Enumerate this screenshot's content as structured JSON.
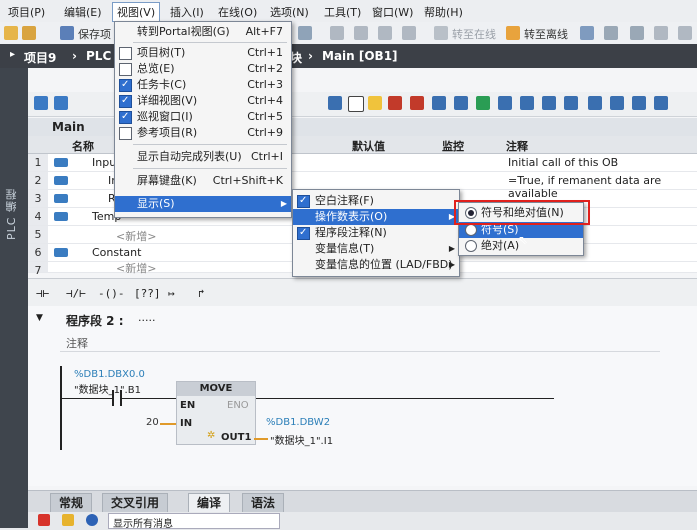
{
  "menubar": {
    "items": [
      "项目(P)",
      "编辑(E)",
      "视图(V)",
      "插入(I)",
      "在线(O)",
      "选项(N)",
      "工具(T)",
      "窗口(W)",
      "帮助(H)"
    ]
  },
  "toolbar": {
    "save_label": "保存项",
    "go_online": "转至在线",
    "go_offline": "转至离线"
  },
  "titlebar": {
    "project": "项目9",
    "path_start": "PLC",
    "path_block": "块",
    "path_sep": "›",
    "block": "Main [OB1]"
  },
  "sidebar": {
    "label": "PLC 编程"
  },
  "editor": {
    "block_name": "Main",
    "columns": [
      "名称",
      "默认值",
      "监控",
      "注释"
    ],
    "rows": [
      {
        "num": "1",
        "name": "Input",
        "comment": "Initial call of this OB"
      },
      {
        "num": "2",
        "name": "In",
        "comment": "=True, if remanent data are available"
      },
      {
        "num": "3",
        "name": "R",
        "comment": ""
      },
      {
        "num": "4",
        "name": "Temp",
        "comment": ""
      },
      {
        "num": "5",
        "name": "<新增>",
        "comment": ""
      },
      {
        "num": "6",
        "name": "Constant",
        "comment": ""
      },
      {
        "num": "7",
        "name": "<新增>",
        "comment": ""
      }
    ]
  },
  "ladder_symbols": [
    "⊣⊢",
    "⊣/⊢",
    "-()-",
    "[??]",
    "↦",
    "↱"
  ],
  "network": {
    "title": "程序段 2 :",
    "title_suffix": ".....",
    "comment": "注释",
    "contact_addr": "%DB1.DBX0.0",
    "contact_sym": "\"数据块_1\".B1",
    "move_title": "MOVE",
    "en": "EN",
    "eno": "ENO",
    "in": "IN",
    "in_value": "20",
    "out": "OUT1",
    "out_addr": "%DB1.DBW2",
    "out_sym": "\"数据块_1\".I1"
  },
  "bottom_tabs": [
    "常规",
    "交叉引用",
    "编译",
    "语法"
  ],
  "statusbar": {
    "filter": "显示所有消息"
  },
  "view_menu": {
    "items": [
      {
        "label": "转到Portal视图(G)",
        "shortcut": "Alt+F7",
        "check": "none"
      },
      {
        "label": "项目树(T)",
        "shortcut": "Ctrl+1",
        "check": "off"
      },
      {
        "label": "总览(E)",
        "shortcut": "Ctrl+2",
        "check": "off"
      },
      {
        "label": "任务卡(C)",
        "shortcut": "Ctrl+3",
        "check": "on"
      },
      {
        "label": "详细视图(V)",
        "shortcut": "Ctrl+4",
        "check": "on"
      },
      {
        "label": "巡视窗口(I)",
        "shortcut": "Ctrl+5",
        "check": "on"
      },
      {
        "label": "参考项目(R)",
        "shortcut": "Ctrl+9",
        "check": "off"
      },
      {
        "label": "显示自动完成列表(U)",
        "shortcut": "Ctrl+I",
        "check": "none"
      },
      {
        "label": "屏幕键盘(K)",
        "shortcut": "Ctrl+Shift+K",
        "check": "none"
      },
      {
        "label": "显示(S)",
        "shortcut": "",
        "check": "none"
      }
    ]
  },
  "display_submenu": {
    "items": [
      {
        "label": "空白注释(F)",
        "check": "on"
      },
      {
        "label": "操作数表示(O)",
        "check": "none"
      },
      {
        "label": "程序段注释(N)",
        "check": "on"
      },
      {
        "label": "变量信息(T)",
        "check": "none"
      },
      {
        "label": "变量信息的位置 (LAD/FBD)",
        "check": "none"
      }
    ]
  },
  "operand_submenu": {
    "items": [
      {
        "label": "符号和绝对值(N)",
        "selected": true
      },
      {
        "label": "符号(S)",
        "selected": false
      },
      {
        "label": "绝对(A)",
        "selected": false
      }
    ]
  },
  "colors": {
    "highlight": "#2f6fcf",
    "annotation_box": "#e0201c",
    "titlebar": "#3c4047"
  }
}
